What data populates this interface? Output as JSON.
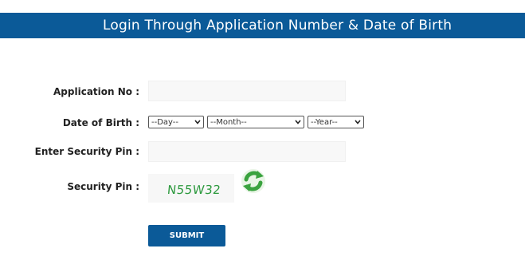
{
  "header": {
    "title": "Login Through Application Number & Date of Birth"
  },
  "form": {
    "application_no": {
      "label": "Application No :",
      "value": "",
      "placeholder": ""
    },
    "date_of_birth": {
      "label": "Date of Birth :",
      "day_selected": "--Day--",
      "month_selected": "--Month--",
      "year_selected": "--Year--"
    },
    "enter_security_pin": {
      "label": "Enter Security Pin :",
      "value": "",
      "placeholder": ""
    },
    "security_pin": {
      "label": "Security Pin :",
      "captcha_code": "N55W32",
      "refresh_icon": "refresh-icon"
    },
    "submit_label": "SUBMIT"
  },
  "colors": {
    "brand_blue": "#0b5a98",
    "captcha_green": "#2e9a3f",
    "refresh_green": "#3aa33f"
  }
}
